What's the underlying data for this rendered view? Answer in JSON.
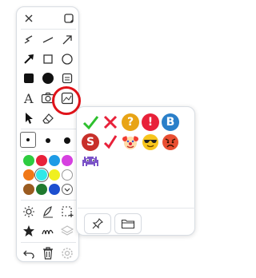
{
  "toolbar": {
    "colors": [
      "#2ecc40",
      "#e8213a",
      "#1e9be6",
      "#d640e0",
      "#f07818",
      "#30e8e8",
      "#f0f020",
      "#ffffff",
      "#9a5b20",
      "#1f7a2e",
      "#1d4fcf"
    ],
    "selected_color": "#30e8e8",
    "tools": [
      "close-icon",
      "maximize-icon",
      "freehand-icon",
      "line-icon",
      "arrow-icon",
      "filled-arrow-icon",
      "rectangle-icon",
      "ellipse-icon",
      "filled-rectangle-icon",
      "filled-ellipse-icon",
      "text-box-icon",
      "text-icon",
      "camera-icon",
      "image-stamp-icon",
      "pointer-icon",
      "eraser-icon",
      "highlighter-icon",
      "pen-icon",
      "select-icon",
      "star-icon",
      "brush-icon",
      "layers-icon",
      "undo-icon",
      "trash-icon",
      "settings-icon"
    ]
  },
  "stamp_panel": {
    "stamps": [
      {
        "name": "green-check",
        "glyph": "✔",
        "color": "#2ec02e"
      },
      {
        "name": "red-cross",
        "glyph": "✘",
        "color": "#e8213a"
      },
      {
        "name": "question",
        "glyph": "?",
        "color": "#e8a416"
      },
      {
        "name": "exclamation",
        "glyph": "!",
        "color": "#e8213a"
      },
      {
        "name": "b-badge",
        "glyph": "B",
        "color": "#2a7fc9"
      },
      {
        "name": "s-badge",
        "glyph": "S",
        "color": "#c8302a"
      },
      {
        "name": "red-check",
        "glyph": "✓",
        "color": "#e8213a"
      },
      {
        "name": "clown",
        "glyph": "🤡",
        "color": ""
      },
      {
        "name": "sunglasses",
        "glyph": "😎",
        "color": ""
      },
      {
        "name": "angry",
        "glyph": "😡",
        "color": ""
      },
      {
        "name": "alien-monster",
        "glyph": "👾",
        "color": ""
      }
    ],
    "buttons": [
      "pin-icon",
      "folder-icon"
    ]
  }
}
